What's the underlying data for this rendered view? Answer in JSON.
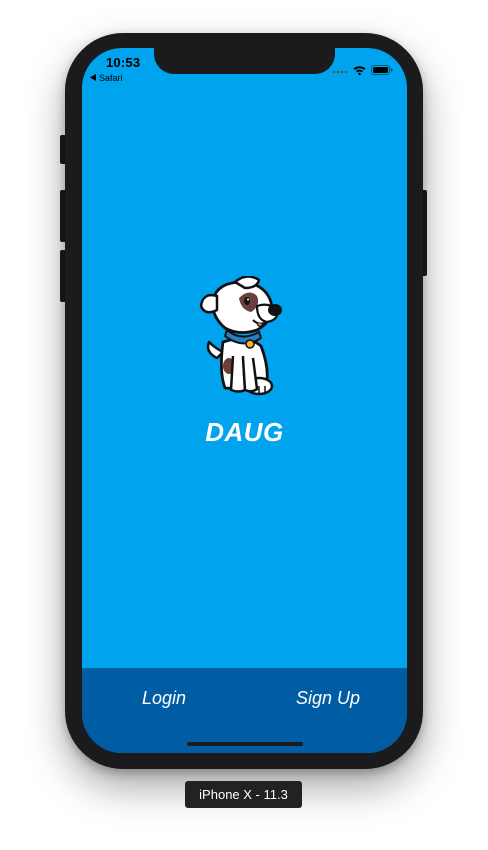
{
  "status_bar": {
    "time": "10:53",
    "back_app": "Safari"
  },
  "app": {
    "title": "DAUG",
    "logo_icon": "dog-mascot-icon",
    "background_color": "#00a3ee"
  },
  "tabbar": {
    "login_label": "Login",
    "signup_label": "Sign Up",
    "background_color": "#005ca3"
  },
  "simulator": {
    "device_label": "iPhone X - 11.3"
  }
}
